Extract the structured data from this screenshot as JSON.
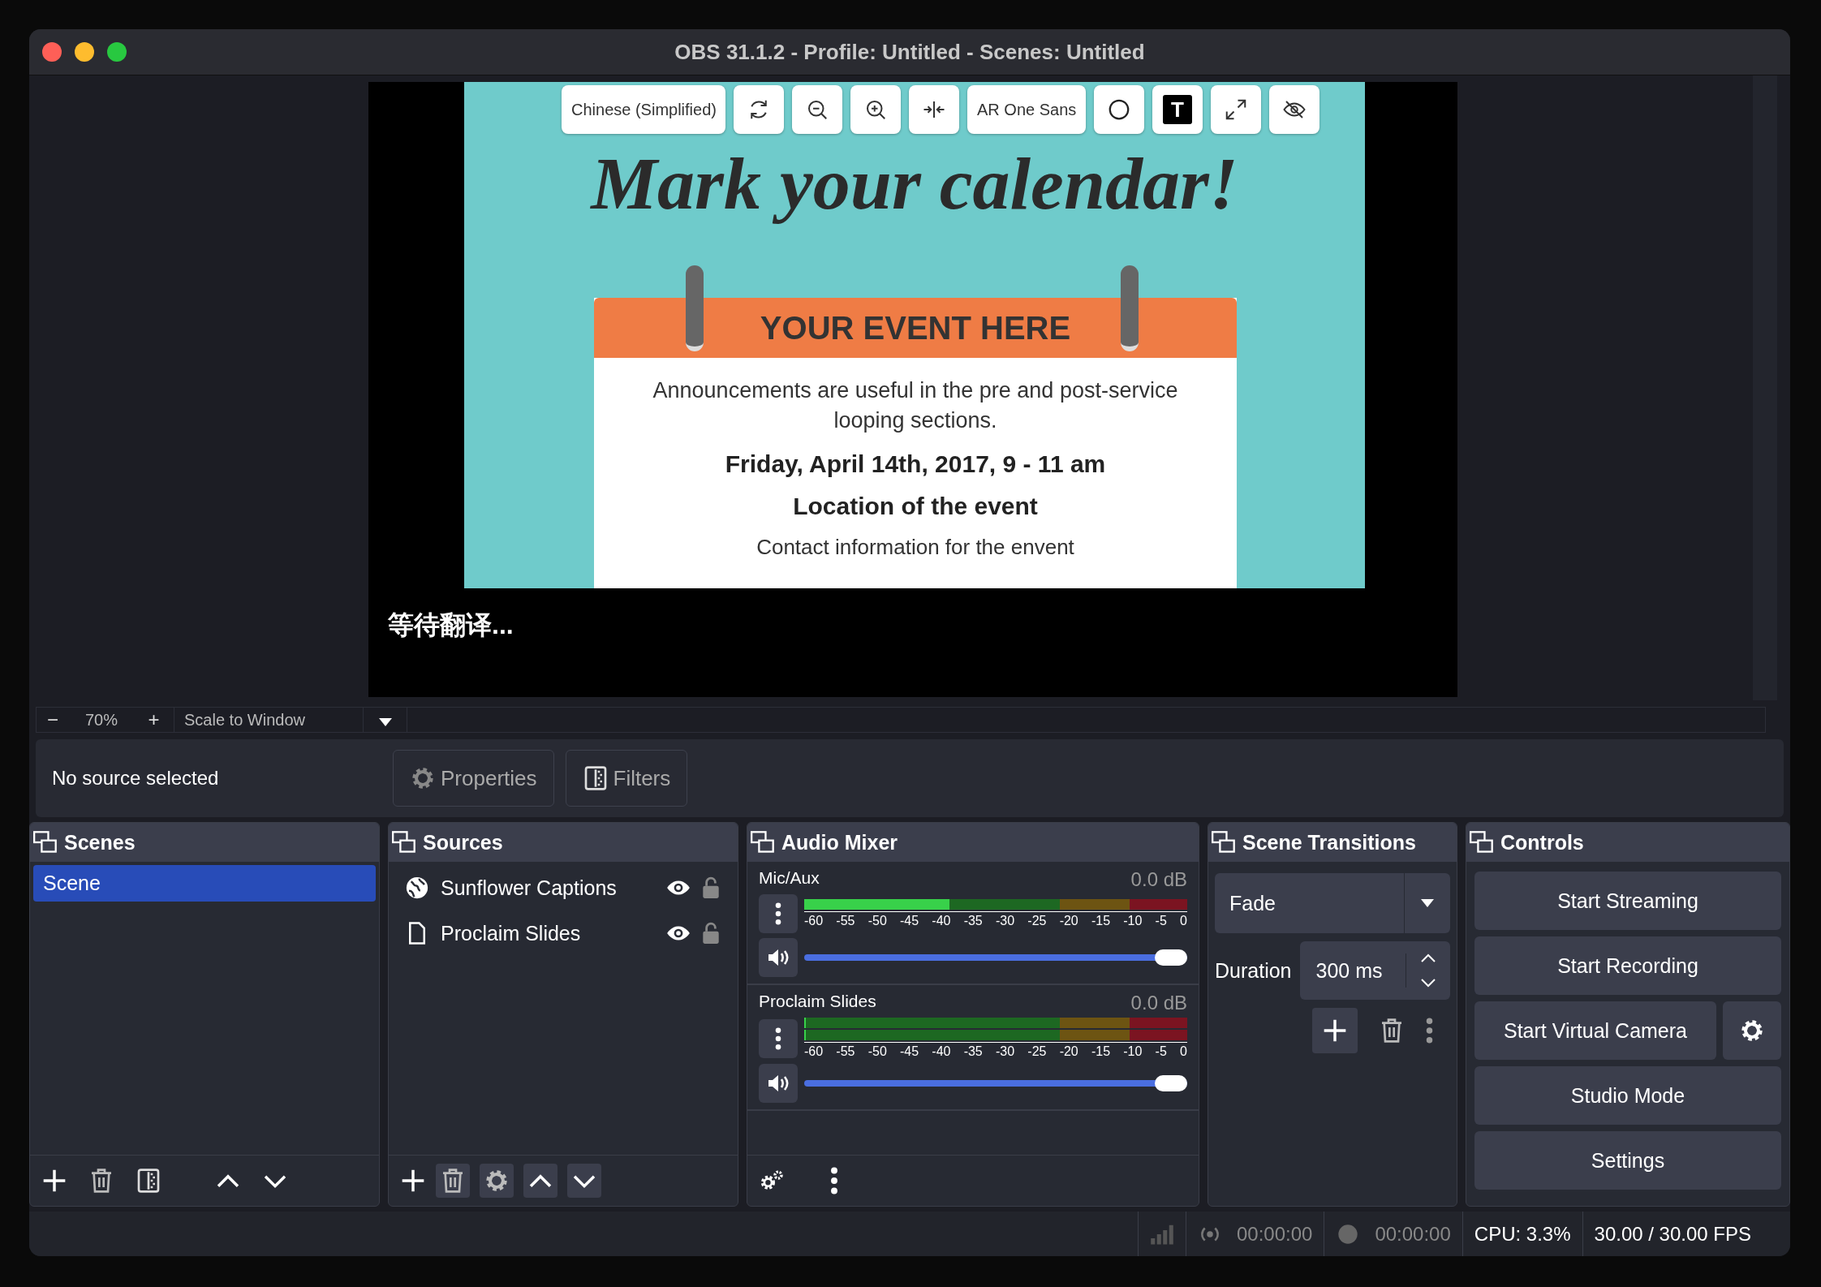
{
  "window": {
    "title": "OBS 31.1.2 - Profile: Untitled - Scenes: Untitled"
  },
  "preview": {
    "caption_toolbar": {
      "language": "Chinese (Simplified)",
      "font": "AR One Sans",
      "text_style": "T"
    },
    "slide": {
      "heading": "Mark your calendar!",
      "banner": "YOUR EVENT HERE",
      "body": "Announcements are useful in the pre and post-service looping sections.",
      "date": "Friday, April 14th, 2017, 9 - 11 am",
      "location": "Location of the event",
      "contact": "Contact information for the envent"
    },
    "caption": "等待翻译..."
  },
  "zoom_bar": {
    "zoom_out": "−",
    "zoom": "70%",
    "zoom_in": "+",
    "scale_mode": "Scale to Window"
  },
  "source_bar": {
    "status": "No source selected",
    "buttons": [
      {
        "label": "Properties",
        "kind": "properties"
      },
      {
        "label": "Filters",
        "kind": "filters"
      }
    ]
  },
  "scenes": {
    "title": "Scenes",
    "items": [
      {
        "name": "Scene",
        "selected": true
      }
    ]
  },
  "sources": {
    "title": "Sources",
    "items": [
      {
        "name": "Sunflower Captions",
        "kind": "browser",
        "visible": true,
        "locked": false
      },
      {
        "name": "Proclaim Slides",
        "kind": "slides",
        "visible": true,
        "locked": false
      }
    ]
  },
  "audio_mixer": {
    "title": "Audio Mixer",
    "channels": [
      {
        "name": "Mic/Aux",
        "reading": "0.0 dB",
        "meters": [
          {
            "level": 0.38
          }
        ],
        "scale": [
          "-60",
          "-55",
          "-50",
          "-45",
          "-40",
          "-35",
          "-30",
          "-25",
          "-20",
          "-15",
          "-10",
          "-5",
          "0"
        ],
        "volume": {
          "level": 1
        }
      },
      {
        "name": "Proclaim Slides",
        "reading": "0.0 dB",
        "meters": [
          {
            "level": 0
          },
          {
            "level": 0
          }
        ],
        "scale": [
          "-60",
          "-55",
          "-50",
          "-45",
          "-40",
          "-35",
          "-30",
          "-25",
          "-20",
          "-15",
          "-10",
          "-5",
          "0"
        ],
        "volume": {
          "level": 1
        }
      }
    ]
  },
  "scene_transitions": {
    "title": "Scene Transitions",
    "transition": "Fade",
    "duration_label": "Duration",
    "duration": "300 ms"
  },
  "controls": {
    "title": "Controls",
    "buttons": [
      {
        "label": "Start Streaming",
        "settings": false
      },
      {
        "label": "Start Recording",
        "settings": false
      },
      {
        "label": "Start Virtual Camera",
        "settings": true
      },
      {
        "label": "Studio Mode",
        "settings": false
      },
      {
        "label": "Settings",
        "settings": false
      }
    ]
  },
  "status_bar": {
    "stream_time": "00:00:00",
    "record_time": "00:00:00",
    "cpu": "CPU: 3.3%",
    "fps": "30.00 / 30.00 FPS"
  }
}
